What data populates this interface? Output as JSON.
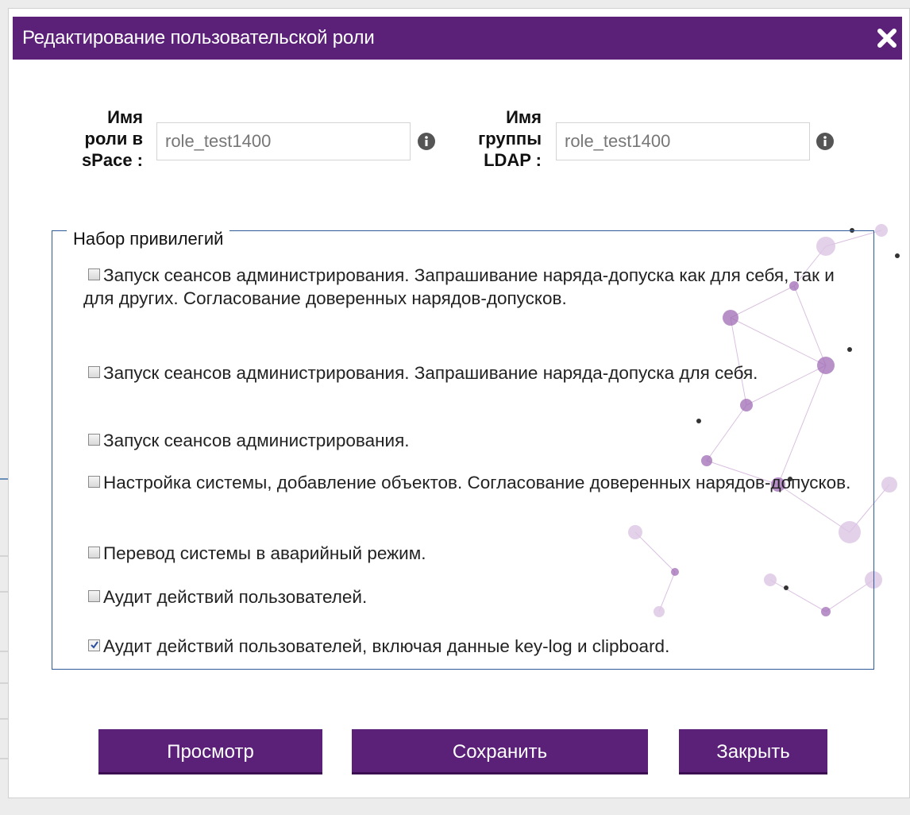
{
  "dialog": {
    "title": "Редактирование пользовательской роли",
    "close_icon": "close-icon"
  },
  "form": {
    "role_label": [
      "Имя",
      "роли в",
      "sPace :"
    ],
    "role_value": "role_test1400",
    "ldap_label": [
      "Имя",
      "группы",
      "LDAP :"
    ],
    "ldap_value": "role_test1400",
    "info_icon": "info-icon"
  },
  "privileges": {
    "legend": "Набор привилегий",
    "items": [
      {
        "label": "Запуск сеансов администрирования. Запрашивание наряда-допуска как для себя, так и для других. Согласование доверенных нарядов-допусков.",
        "checked": false
      },
      {
        "label": "Запуск сеансов администрирования. Запрашивание наряда-допуска для себя.",
        "checked": false
      },
      {
        "label": "Запуск сеансов администрирования.",
        "checked": false
      },
      {
        "label": "Настройка системы, добавление объектов. Согласование доверенных нарядов-допусков.",
        "checked": false
      },
      {
        "label": "Перевод системы в аварийный режим.",
        "checked": false
      },
      {
        "label": "Аудит действий пользователей.",
        "checked": false
      },
      {
        "label": "Аудит действий пользователей, включая данные key-log и clipboard.",
        "checked": true
      }
    ]
  },
  "buttons": {
    "preview": "Просмотр",
    "save": "Сохранить",
    "close": "Закрыть"
  },
  "colors": {
    "accent": "#5b2078",
    "fieldset_border": "#2f5b9a"
  }
}
